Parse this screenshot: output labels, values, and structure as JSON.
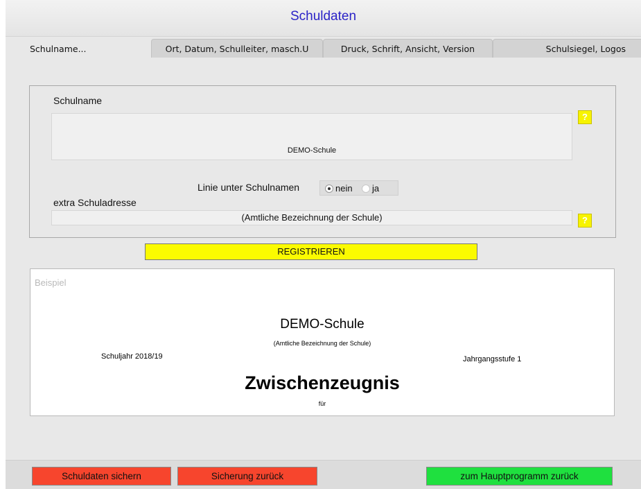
{
  "window": {
    "title": "Schuldaten"
  },
  "tabs": [
    {
      "label": "Schulname...",
      "active": true
    },
    {
      "label": "Ort, Datum, Schulleiter, masch.U",
      "active": false
    },
    {
      "label": "Druck, Schrift, Ansicht, Version",
      "active": false
    },
    {
      "label": "Schulsiegel, Logos",
      "active": false
    }
  ],
  "form": {
    "schulname_label": "Schulname",
    "schulname_value": "DEMO-Schule",
    "help_glyph": "?",
    "linie_label": "Linie unter Schulnamen",
    "linie_options": [
      "nein",
      "ja"
    ],
    "linie_selected": "nein",
    "adresse_label": "extra Schuladresse",
    "adresse_value": "(Amtliche Bezeichnung der Schule)",
    "register_label": "REGISTRIEREN"
  },
  "preview": {
    "heading": "Beispiel",
    "school_name": "DEMO-Schule",
    "school_subtitle": "(Amtliche Bezeichnung der Schule)",
    "schuljahr": "Schuljahr 2018/19",
    "jahrgang": "Jahrgangsstufe 1",
    "doc_title": "Zwischenzeugnis",
    "fuer": "für"
  },
  "footer": {
    "save_label": "Schuldaten sichern",
    "restore_label": "Sicherung zurück",
    "back_label": "zum Hauptprogramm zurück"
  },
  "colors": {
    "title": "#2b23c7",
    "register": "#fbfb00",
    "help": "#f7f300",
    "danger": "#f7452d",
    "success": "#1fe03f"
  },
  "icons": {
    "help": "help-icon",
    "radio": "radio-button"
  }
}
